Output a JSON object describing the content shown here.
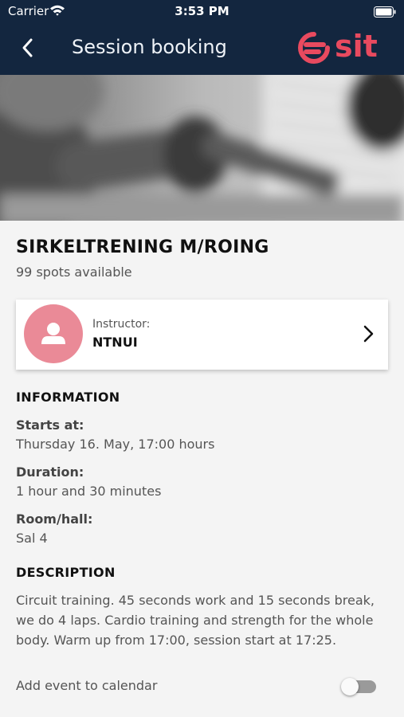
{
  "status_bar": {
    "carrier": "Carrier",
    "time": "3:53 PM"
  },
  "nav": {
    "title": "Session booking",
    "logo_text": "sit",
    "brand_color": "#e84a5f",
    "bar_color": "#13263f"
  },
  "session": {
    "title": "SIRKELTRENING M/ROING",
    "spots": "99 spots available"
  },
  "instructor": {
    "label": "Instructor:",
    "name": "NTNUI",
    "avatar_color": "#ea8a97"
  },
  "information": {
    "heading": "INFORMATION",
    "starts_label": "Starts at:",
    "starts_value": "Thursday 16. May, 17:00 hours",
    "duration_label": "Duration:",
    "duration_value": "1 hour and 30 minutes",
    "room_label": "Room/hall:",
    "room_value": "Sal 4"
  },
  "description": {
    "heading": "DESCRIPTION",
    "text": "Circuit training. 45 seconds work and 15 seconds break, we do 4 laps. Cardio training and strength for the whole body. Warm up from 17:00, session start at 17:25."
  },
  "calendar": {
    "label": "Add event to calendar",
    "enabled": false
  }
}
